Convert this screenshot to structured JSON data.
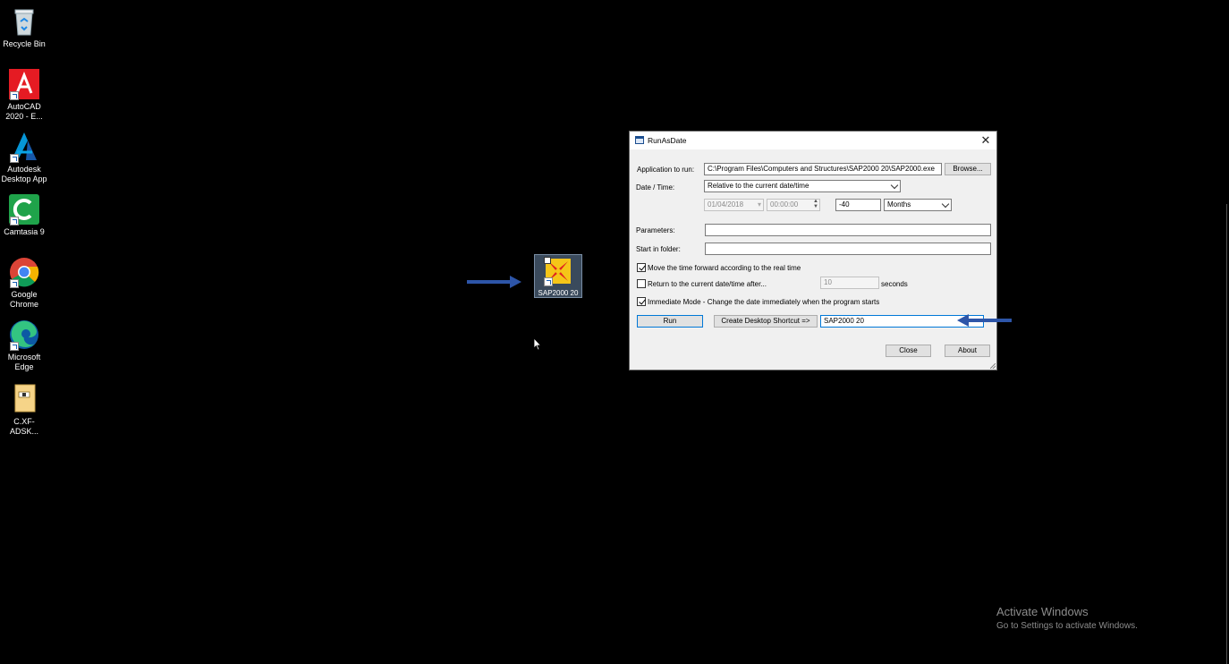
{
  "desktop": {
    "icons": [
      {
        "label": "Recycle Bin"
      },
      {
        "label": "AutoCAD 2020 - E..."
      },
      {
        "label": "Autodesk Desktop App"
      },
      {
        "label": "Camtasia 9"
      },
      {
        "label": "Google Chrome"
      },
      {
        "label": "Microsoft Edge"
      },
      {
        "label": "C.XF-ADSK..."
      }
    ],
    "selected_icon_label": "SAP2000 20"
  },
  "dialog": {
    "title": "RunAsDate",
    "app_label": "Application to run:",
    "app_path": "C:\\Program Files\\Computers and Structures\\SAP2000 20\\SAP2000.exe",
    "browse_label": "Browse...",
    "datetime_label": "Date / Time:",
    "datetime_mode": "Relative to the current date/time",
    "date_value": "01/04/2018",
    "time_value": "00:00:00",
    "offset_value": "-40",
    "offset_unit": "Months",
    "parameters_label": "Parameters:",
    "parameters_value": "",
    "start_folder_label": "Start in folder:",
    "start_folder_value": "",
    "move_forward_label": "Move the time forward according to the real time",
    "move_forward_checked": true,
    "return_label": "Return to the current date/time after...",
    "return_checked": false,
    "return_seconds": "10",
    "seconds_label": "seconds",
    "immediate_label": "Immediate Mode - Change the date immediately when the program starts",
    "immediate_checked": true,
    "run_label": "Run",
    "create_shortcut_label": "Create Desktop Shortcut =>",
    "shortcut_name": "SAP2000 20",
    "close_label": "Close",
    "about_label": "About"
  },
  "watermark": {
    "line1": "Activate Windows",
    "line2": "Go to Settings to activate Windows."
  },
  "colors": {
    "annotation_arrow": "#2d55a8",
    "focus_border": "#0078d7"
  }
}
